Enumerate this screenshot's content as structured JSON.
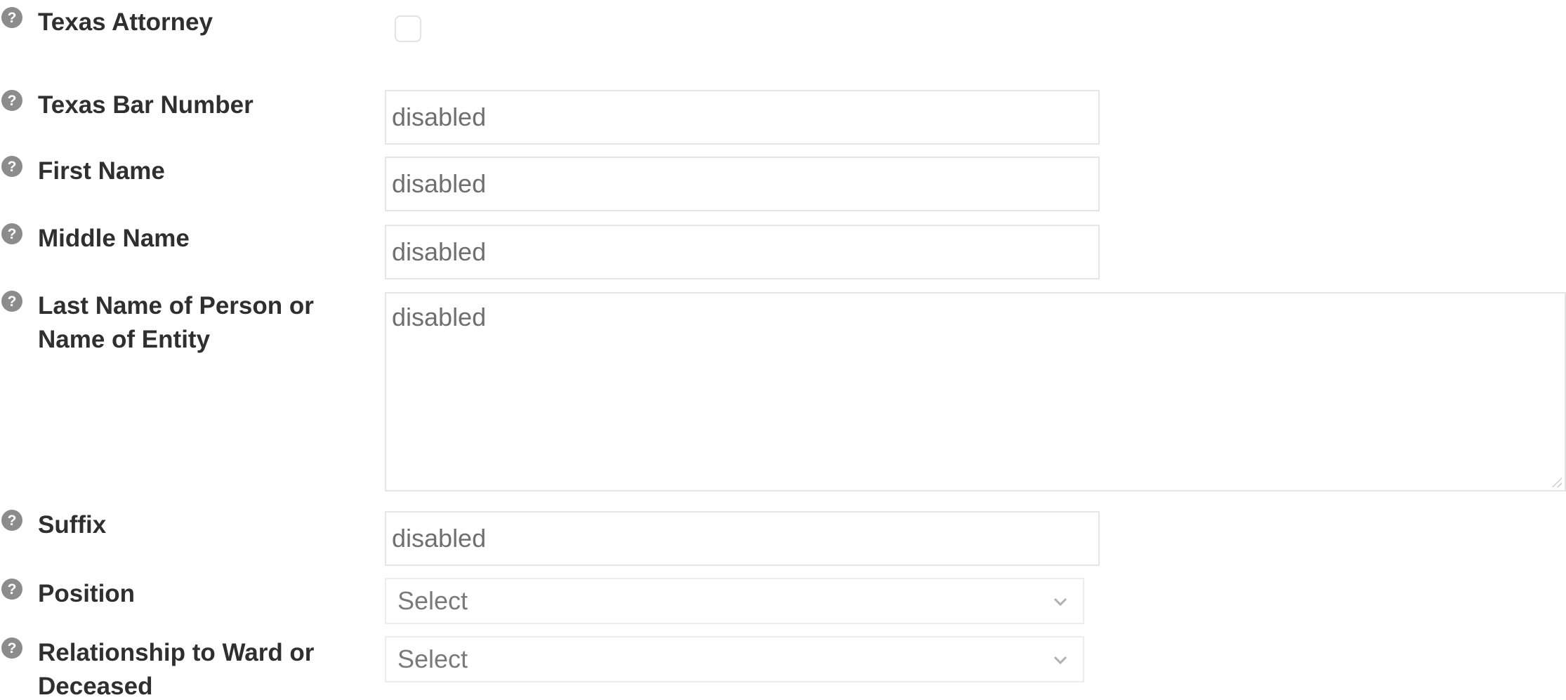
{
  "form": {
    "texas_attorney": {
      "label": "Texas Attorney"
    },
    "texas_bar_number": {
      "label": "Texas Bar Number",
      "value": "disabled"
    },
    "first_name": {
      "label": "First Name",
      "value": "disabled"
    },
    "middle_name": {
      "label": "Middle Name",
      "value": "disabled"
    },
    "last_name": {
      "label_line1": "Last Name of Person or",
      "label_line2": "Name of Entity",
      "value": "disabled"
    },
    "suffix": {
      "label": "Suffix",
      "value": "disabled"
    },
    "position": {
      "label": "Position",
      "value": "Select"
    },
    "relationship": {
      "label_line1": "Relationship to Ward or",
      "label_line2": "Deceased",
      "value": "Select"
    }
  },
  "icons": {
    "help": "question-circle-icon",
    "select": "chevron-down-icon"
  },
  "colors": {
    "label": "#2f2f2f",
    "field_text": "#6f6f6f",
    "border": "#e5e5e5",
    "icon": "#8c8c8c"
  }
}
